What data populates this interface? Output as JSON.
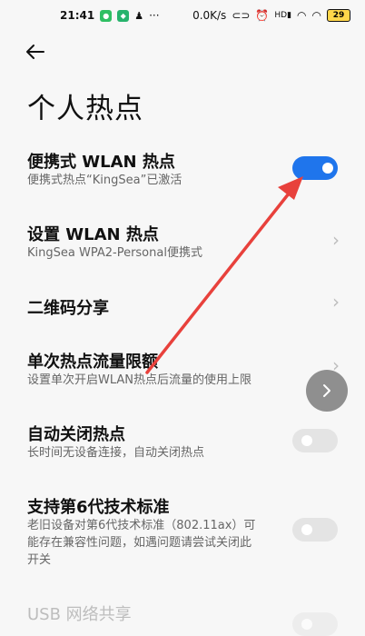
{
  "status": {
    "time": "21:41",
    "speed": "0.0K/s",
    "battery": "29"
  },
  "header": {
    "title": "个人热点"
  },
  "settings": {
    "portable_wlan": {
      "title": "便携式 WLAN 热点",
      "subtitle": "便携式热点“KingSea”已激活",
      "enabled": true
    },
    "setup_wlan": {
      "title": "设置 WLAN 热点",
      "subtitle": "KingSea WPA2-Personal便携式"
    },
    "qr_share": {
      "title": "二维码分享"
    },
    "data_limit": {
      "title": "单次热点流量限额",
      "subtitle": "设置单次开启WLAN热点后流量的使用上限"
    },
    "auto_close": {
      "title": "自动关闭热点",
      "subtitle": "长时间无设备连接，自动关闭热点",
      "enabled": false
    },
    "wifi6": {
      "title": "支持第6代技术标准",
      "subtitle_line1": "老旧设备对第6代技术标准（802.11ax）可",
      "subtitle_line2": "能存在兼容性问题，如遇问题请尝试关闭此",
      "subtitle_line3": "开关",
      "enabled": false
    },
    "usb_share": {
      "title": "USB 网络共享"
    }
  },
  "colors": {
    "accent": "#1f75ec",
    "annotation_arrow": "#e8413c"
  },
  "icons": {
    "back": "arrow-left-icon",
    "chevron": "chevron-right-icon",
    "fab": "chevron-right-icon"
  }
}
